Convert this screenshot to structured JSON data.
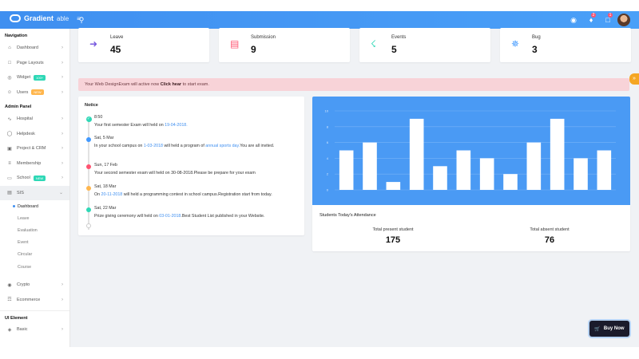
{
  "brand": {
    "name": "Gradient",
    "sub": "able"
  },
  "topbar": {
    "notif_count": "2",
    "msg_count": "1"
  },
  "sidebar": {
    "sections": [
      {
        "title": "Navigation",
        "items": [
          {
            "label": "Dashboard",
            "icon": "home-icon"
          },
          {
            "label": "Page Layouts",
            "icon": "layout-icon"
          },
          {
            "label": "Widget",
            "icon": "widget-icon",
            "tag": "100+",
            "tag_color": "#2ed8b6"
          },
          {
            "label": "Users",
            "icon": "users-icon",
            "tag": "NEW",
            "tag_color": "#ffb64d"
          }
        ]
      },
      {
        "title": "Admin Panel",
        "items": [
          {
            "label": "Hospital",
            "icon": "activity-icon"
          },
          {
            "label": "Helpdesk",
            "icon": "help-icon"
          },
          {
            "label": "Project & CRM",
            "icon": "briefcase-icon"
          },
          {
            "label": "Membership",
            "icon": "membership-icon"
          },
          {
            "label": "School",
            "icon": "school-icon",
            "tag": "NEW",
            "tag_color": "#2ed8b6"
          },
          {
            "label": "SIS",
            "icon": "book-icon",
            "active": true,
            "open": true
          }
        ]
      }
    ],
    "sis_sub": [
      "Dashboard",
      "Leave",
      "Evaluation",
      "Event",
      "Circular",
      "Course"
    ],
    "after": [
      {
        "label": "Crypto",
        "icon": "crypto-icon"
      },
      {
        "label": "Ecommerce",
        "icon": "cart-icon"
      }
    ],
    "ui_title": "UI Element",
    "ui_items": [
      {
        "label": "Basic",
        "icon": "basic-icon"
      }
    ]
  },
  "stats": [
    {
      "label": "Leave",
      "value": "45",
      "icon": "logout-icon",
      "color": "#7759de"
    },
    {
      "label": "Submission",
      "value": "9",
      "icon": "book-icon",
      "color": "#ff5370"
    },
    {
      "label": "Events",
      "value": "5",
      "icon": "run-icon",
      "color": "#2ed8b6"
    },
    {
      "label": "Bug",
      "value": "3",
      "icon": "bug-icon",
      "color": "#4099ff"
    }
  ],
  "alert": {
    "pre": "Your Web DesignExam will active now ",
    "bold": "Click hear",
    "post": " to start exam."
  },
  "notice": {
    "title": "Notice",
    "items": [
      {
        "date": "8:50",
        "color": "#2ed8b6",
        "check": true,
        "parts": [
          {
            "t": "Your first semester Exam will held on "
          },
          {
            "t": "19-04-2018.",
            "link": true
          }
        ]
      },
      {
        "date": "Sat, 5 Mar",
        "color": "#4099ff",
        "parts": [
          {
            "t": "In your school campus on "
          },
          {
            "t": "1-03-2018",
            "link": true
          },
          {
            "t": " will held a program of "
          },
          {
            "t": "annual sports day.",
            "link": true
          },
          {
            "t": "You are all invited."
          }
        ]
      },
      {
        "date": "Sun, 17 Feb",
        "color": "#ff5370",
        "parts": [
          {
            "t": "Your second semester exam will held on 30-08-2018.Please be prepare for your exam"
          }
        ]
      },
      {
        "date": "Sat, 18 Mar",
        "color": "#ffb64d",
        "parts": [
          {
            "t": "On "
          },
          {
            "t": "20-11-2018",
            "link": true
          },
          {
            "t": " will held a programming contest in school campus.Registration start from today."
          }
        ]
      },
      {
        "date": "Sat, 22 Mar",
        "color": "#2ed8b6",
        "parts": [
          {
            "t": "Prize giving ceremony will held on "
          },
          {
            "t": "03-01-2018",
            "link": true
          },
          {
            "t": ".Best Student List published in your Website."
          }
        ]
      }
    ]
  },
  "chart_data": {
    "type": "bar",
    "yticks": [
      "0",
      "2",
      "4",
      "6",
      "8",
      "10"
    ],
    "ylim": [
      0,
      10
    ],
    "values": [
      5,
      6,
      1,
      9,
      3,
      5,
      4,
      2,
      6,
      9,
      4,
      5
    ],
    "bar_color": "#ffffff",
    "bg_color": "#4a9af4"
  },
  "attendance": {
    "title": "Students Today's Attendance",
    "present_label": "Total present student",
    "present_value": "175",
    "absent_label": "Total absent student",
    "absent_value": "76"
  },
  "buy": {
    "label": "Buy Now"
  }
}
